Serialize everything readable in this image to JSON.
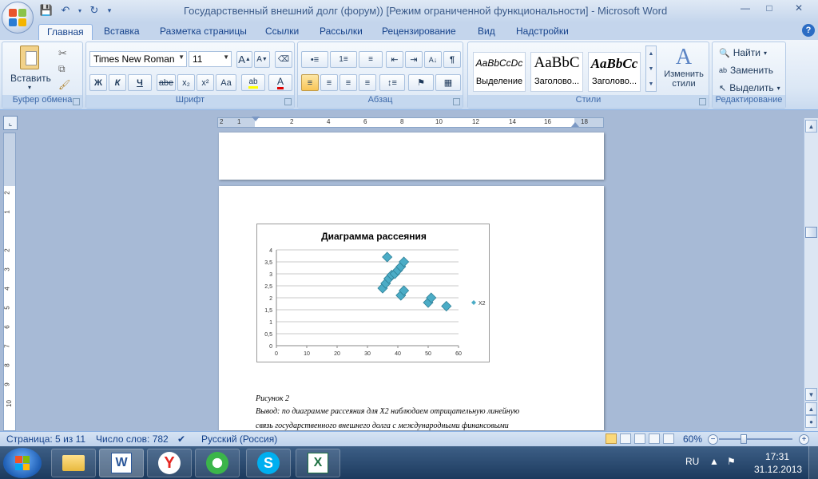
{
  "window": {
    "title": "Государственный внешний долг (форум)) [Режим ограниченной функциональности] - Microsoft Word"
  },
  "tabs": [
    "Главная",
    "Вставка",
    "Разметка страницы",
    "Ссылки",
    "Рассылки",
    "Рецензирование",
    "Вид",
    "Надстройки"
  ],
  "ribbon": {
    "clipboard": {
      "label": "Буфер обмена",
      "paste": "Вставить"
    },
    "font": {
      "label": "Шрифт",
      "family": "Times New Roman",
      "size": "11",
      "bold": "Ж",
      "italic": "К",
      "underline": "Ч",
      "strike": "abe",
      "subscript": "x₂",
      "superscript": "x²",
      "case": "Aa",
      "grow": "A",
      "shrink": "A"
    },
    "paragraph": {
      "label": "Абзац",
      "marks": "¶"
    },
    "styles": {
      "label": "Стили",
      "items": [
        {
          "sample": "AaBbCcDc",
          "name": "Выделение"
        },
        {
          "sample": "AaBbC",
          "name": "Заголово..."
        },
        {
          "sample": "AaBbCc",
          "name": "Заголово..."
        }
      ],
      "change": "Изменить",
      "change2": "стили"
    },
    "editing": {
      "label": "Редактирование",
      "find": "Найти",
      "replace": "Заменить",
      "select": "Выделить"
    }
  },
  "ruler": {
    "h_ticks": [
      "2",
      "1",
      "2",
      "4",
      "6",
      "8",
      "10",
      "12",
      "14",
      "16",
      "18"
    ],
    "v_ticks": [
      "2",
      "1",
      "2",
      "3",
      "4",
      "5",
      "6",
      "7",
      "8",
      "9",
      "10"
    ]
  },
  "chart_data": {
    "type": "scatter",
    "title": "Диаграмма рассеяния",
    "legend": "right",
    "series": [
      {
        "name": "X2",
        "color": "#4bacc6",
        "points": [
          [
            35,
            2.4
          ],
          [
            36,
            2.6
          ],
          [
            37,
            2.8
          ],
          [
            38,
            2.95
          ],
          [
            39,
            3.0
          ],
          [
            40,
            3.15
          ],
          [
            41,
            3.3
          ],
          [
            42,
            3.5
          ],
          [
            36.5,
            3.7
          ],
          [
            41,
            2.1
          ],
          [
            42,
            2.3
          ],
          [
            50,
            1.8
          ],
          [
            51,
            2.0
          ],
          [
            56,
            1.65
          ]
        ]
      }
    ],
    "x_ticks": [
      "0",
      "10",
      "20",
      "30",
      "40",
      "50",
      "60"
    ],
    "y_ticks": [
      "0",
      "0,5",
      "1",
      "1,5",
      "2",
      "2,5",
      "3",
      "3,5",
      "4"
    ],
    "xlim": [
      0,
      60
    ],
    "ylim": [
      0,
      4
    ],
    "grid": "horizontal"
  },
  "document": {
    "caption": "Рисунок 2",
    "line1": "Вывод: по диаграмме рассеяния для X2 наблюдаем отрицательную линейную",
    "line2": "связь государственного внешнего долга с международными финансовыми"
  },
  "status": {
    "page": "Страница: 5 из 11",
    "words": "Число слов: 782",
    "language": "Русский (Россия)",
    "zoom": "60%"
  },
  "taskbar": {
    "lang": "RU",
    "time": "17:31",
    "date": "31.12.2013"
  }
}
